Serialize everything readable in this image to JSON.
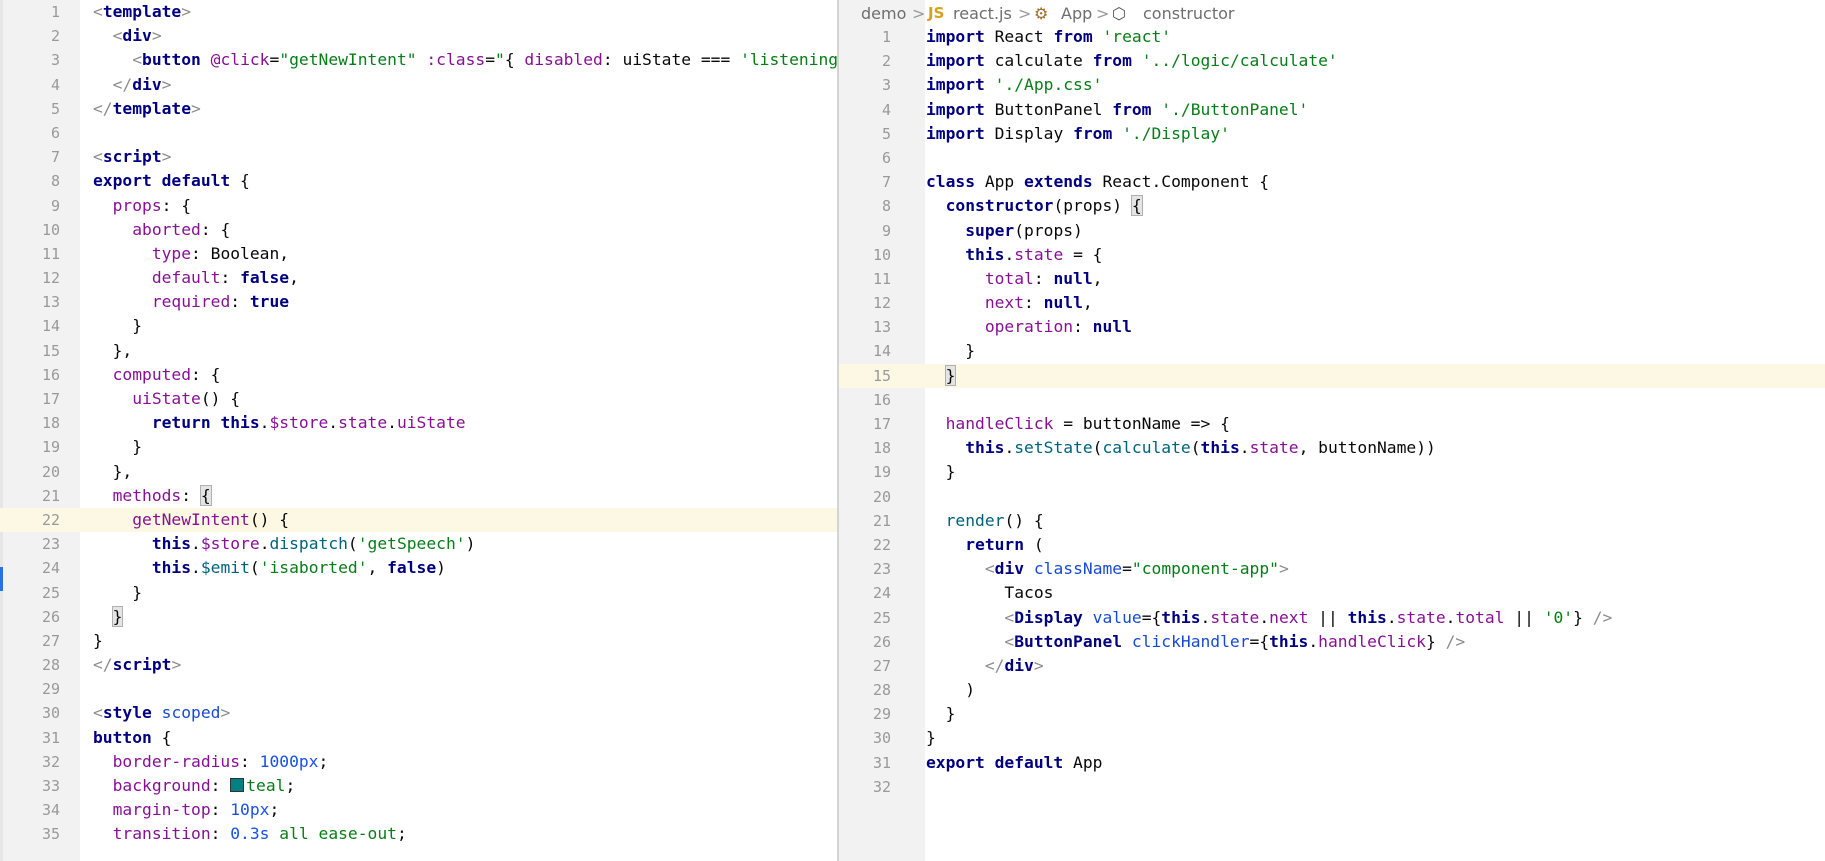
{
  "breadcrumb": {
    "project": "demo",
    "file_icon_text": "JS",
    "file": "react.js",
    "class_name": "App",
    "method_name": "constructor"
  },
  "left_editor": {
    "file_type": "vue",
    "highlighted_line": 22,
    "lines": [
      {
        "n": "1",
        "h": "<span class=\"c\">&lt;</span><span class=\"t\">template</span><span class=\"c\">&gt;</span>"
      },
      {
        "n": "2",
        "h": "  <span class=\"c\">&lt;</span><span class=\"t\">div</span><span class=\"c\">&gt;</span>"
      },
      {
        "n": "3",
        "h": "    <span class=\"c\">&lt;</span><span class=\"t\">button</span> <span class=\"p\">@click</span>=<span class=\"s\">\"getNewIntent\"</span> <span class=\"p\">:class</span>=<span class=\"s\">\"</span>{ <span class=\"p\">disabled</span>: uiState === <span class=\"s\">'listening'</span>"
      },
      {
        "n": "4",
        "h": "  <span class=\"c\">&lt;/</span><span class=\"t\">div</span><span class=\"c\">&gt;</span>"
      },
      {
        "n": "5",
        "h": "<span class=\"c\">&lt;/</span><span class=\"t\">template</span><span class=\"c\">&gt;</span>"
      },
      {
        "n": "6",
        "h": ""
      },
      {
        "n": "7",
        "h": "<span class=\"c\">&lt;</span><span class=\"t\">script</span><span class=\"c\">&gt;</span>"
      },
      {
        "n": "8",
        "h": "<span class=\"k\">export default</span> {"
      },
      {
        "n": "9",
        "h": "  <span class=\"p\">props</span>: {"
      },
      {
        "n": "10",
        "h": "    <span class=\"p\">aborted</span>: {"
      },
      {
        "n": "11",
        "h": "      <span class=\"p\">type</span>: Boolean,"
      },
      {
        "n": "12",
        "h": "      <span class=\"p\">default</span>: <span class=\"k\">false</span>,"
      },
      {
        "n": "13",
        "h": "      <span class=\"p\">required</span>: <span class=\"k\">true</span>"
      },
      {
        "n": "14",
        "h": "    }"
      },
      {
        "n": "15",
        "h": "  },"
      },
      {
        "n": "16",
        "h": "  <span class=\"p\">computed</span>: {"
      },
      {
        "n": "17",
        "h": "    <span class=\"p\">uiState</span>() {"
      },
      {
        "n": "18",
        "h": "      <span class=\"k\">return this</span>.<span class=\"p\">$store</span>.<span class=\"p\">state</span>.<span class=\"p\">uiState</span>"
      },
      {
        "n": "19",
        "h": "    }"
      },
      {
        "n": "20",
        "h": "  },"
      },
      {
        "n": "21",
        "h": "  <span class=\"p\">methods</span>: <span class=\"br\">{</span>"
      },
      {
        "n": "22",
        "h": "    <span class=\"p\">getNewIntent</span>() {"
      },
      {
        "n": "23",
        "h": "      <span class=\"k\">this</span>.<span class=\"p\">$store</span>.<span class=\"f\">dispatch</span>(<span class=\"s\">'getSpeech'</span>)"
      },
      {
        "n": "24",
        "h": "      <span class=\"k\">this</span>.<span class=\"f\">$emit</span>(<span class=\"s\">'isaborted'</span>, <span class=\"k\">false</span>)"
      },
      {
        "n": "25",
        "h": "    }"
      },
      {
        "n": "26",
        "h": "  <span class=\"br\">}</span>"
      },
      {
        "n": "27",
        "h": "}"
      },
      {
        "n": "28",
        "h": "<span class=\"c\">&lt;/</span><span class=\"t\">script</span><span class=\"c\">&gt;</span>"
      },
      {
        "n": "29",
        "h": ""
      },
      {
        "n": "30",
        "h": "<span class=\"c\">&lt;</span><span class=\"t\">style</span> <span class=\"a\">scoped</span><span class=\"c\">&gt;</span>"
      },
      {
        "n": "31",
        "h": "<span class=\"t\">button</span> {"
      },
      {
        "n": "32",
        "h": "  <span class=\"p\">border-radius</span>: <span class=\"n\">1000px</span>;"
      },
      {
        "n": "33",
        "h": "  <span class=\"p\">background</span>: <span class=\"swatch\"></span><span class=\"s\">teal</span>;"
      },
      {
        "n": "34",
        "h": "  <span class=\"p\">margin-top</span>: <span class=\"n\">10px</span>;"
      },
      {
        "n": "35",
        "h": "  <span class=\"p\">transition</span>: <span class=\"n\">0.3s</span> <span class=\"s\">all</span> <span class=\"s\">ease-out</span>;"
      }
    ]
  },
  "right_editor": {
    "file_type": "js",
    "highlighted_line": 15,
    "lines": [
      {
        "n": "1",
        "h": "<span class=\"k\">import</span> React <span class=\"k\">from</span> <span class=\"s\">'react'</span>"
      },
      {
        "n": "2",
        "h": "<span class=\"k\">import</span> calculate <span class=\"k\">from</span> <span class=\"s\">'../logic/calculate'</span>"
      },
      {
        "n": "3",
        "h": "<span class=\"k\">import</span> <span class=\"s\">'./App.css'</span>"
      },
      {
        "n": "4",
        "h": "<span class=\"k\">import</span> ButtonPanel <span class=\"k\">from</span> <span class=\"s\">'./ButtonPanel'</span>"
      },
      {
        "n": "5",
        "h": "<span class=\"k\">import</span> Display <span class=\"k\">from</span> <span class=\"s\">'./Display'</span>"
      },
      {
        "n": "6",
        "h": ""
      },
      {
        "n": "7",
        "h": "<span class=\"k\">class</span> App <span class=\"k\">extends</span> React.Component {"
      },
      {
        "n": "8",
        "h": "  <span class=\"k\">constructor</span>(props) <span class=\"br\">{</span>"
      },
      {
        "n": "9",
        "h": "    <span class=\"k\">super</span>(props)"
      },
      {
        "n": "10",
        "h": "    <span class=\"k\">this</span>.<span class=\"p\">state</span> = {"
      },
      {
        "n": "11",
        "h": "      <span class=\"p\">total</span>: <span class=\"k\">null</span>,"
      },
      {
        "n": "12",
        "h": "      <span class=\"p\">next</span>: <span class=\"k\">null</span>,"
      },
      {
        "n": "13",
        "h": "      <span class=\"p\">operation</span>: <span class=\"k\">null</span>"
      },
      {
        "n": "14",
        "h": "    }"
      },
      {
        "n": "15",
        "h": "  <span class=\"br\">}</span>"
      },
      {
        "n": "16",
        "h": ""
      },
      {
        "n": "17",
        "h": "  <span class=\"p\">handleClick</span> = buttonName =&gt; {"
      },
      {
        "n": "18",
        "h": "    <span class=\"k\">this</span>.<span class=\"f\">setState</span>(<span class=\"f\">calculate</span>(<span class=\"k\">this</span>.<span class=\"p\">state</span>, buttonName))"
      },
      {
        "n": "19",
        "h": "  }"
      },
      {
        "n": "20",
        "h": ""
      },
      {
        "n": "21",
        "h": "  <span class=\"f\">render</span>() {"
      },
      {
        "n": "22",
        "h": "    <span class=\"k\">return</span> ("
      },
      {
        "n": "23",
        "h": "      <span class=\"c\">&lt;</span><span class=\"t\">div</span> <span class=\"a\">className</span>=<span class=\"s\">\"component-app\"</span><span class=\"c\">&gt;</span>"
      },
      {
        "n": "24",
        "h": "        Tacos"
      },
      {
        "n": "25",
        "h": "        <span class=\"c\">&lt;</span><span class=\"t\">Display</span> <span class=\"a\">value</span>={<span class=\"k\">this</span>.<span class=\"p\">state</span>.<span class=\"p\">next</span> || <span class=\"k\">this</span>.<span class=\"p\">state</span>.<span class=\"p\">total</span> || <span class=\"s\">'0'</span>} <span class=\"c\">/&gt;</span>"
      },
      {
        "n": "26",
        "h": "        <span class=\"c\">&lt;</span><span class=\"t\">ButtonPanel</span> <span class=\"a\">clickHandler</span>={<span class=\"k\">this</span>.<span class=\"p\">handleClick</span>} <span class=\"c\">/&gt;</span>"
      },
      {
        "n": "27",
        "h": "      <span class=\"c\">&lt;/</span><span class=\"t\">div</span><span class=\"c\">&gt;</span>"
      },
      {
        "n": "28",
        "h": "    )"
      },
      {
        "n": "29",
        "h": "  }"
      },
      {
        "n": "30",
        "h": "}"
      },
      {
        "n": "31",
        "h": "<span class=\"k\">export default</span> App"
      },
      {
        "n": "32",
        "h": ""
      }
    ]
  }
}
